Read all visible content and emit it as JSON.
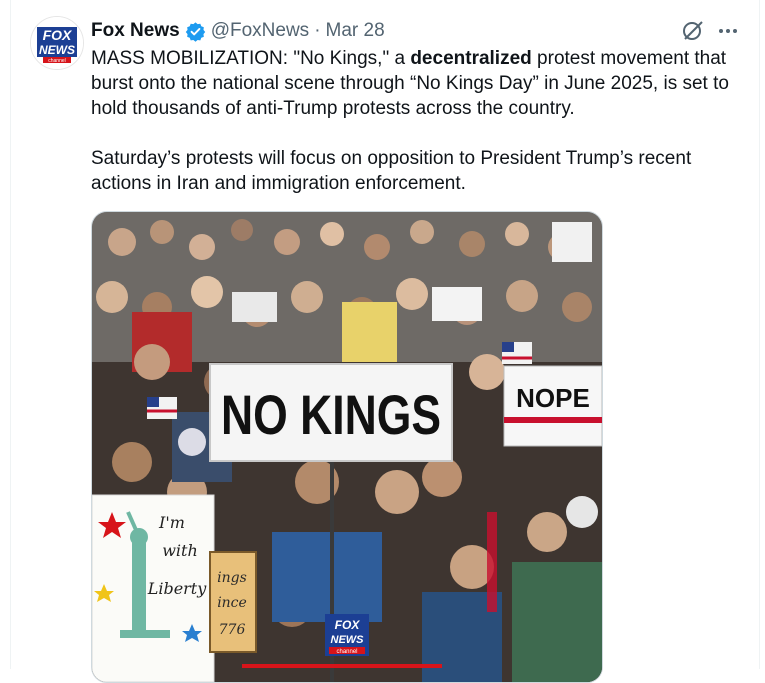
{
  "tweet": {
    "author_name": "Fox News",
    "handle": "@FoxNews",
    "separator": "·",
    "date": "Mar 28",
    "text_p1_prefix": "MASS MOBILIZATION: \"No Kings,\" a ",
    "text_p1_bold": "decentralized",
    "text_p1_suffix": " protest movement that burst onto the national scene through “No Kings Day” in June 2025, is set to hold thousands of anti-Trump protests across the country.",
    "text_p2": "Saturday’s protests will focus on opposition to President Trump’s recent actions in Iran and immigration enforcement."
  },
  "avatar": {
    "logo_line1": "FOX",
    "logo_line2": "NEWS",
    "logo_line3": "channel"
  },
  "photo": {
    "main_sign": "NO KINGS",
    "right_sign": "NOPE",
    "left_sign_line1": "I'm",
    "left_sign_line2": "with",
    "left_sign_line3": "Liberty",
    "partial_sign_line1": "ings",
    "partial_sign_line2": "ince",
    "partial_sign_line3": "776",
    "watermark_line1": "FOX",
    "watermark_line2": "NEWS",
    "watermark_line3": "channel"
  },
  "colors": {
    "verified": "#1d9bf0",
    "fox_blue": "#1c3f94",
    "fox_red": "#d7141a",
    "muted": "#536471"
  },
  "icons": {
    "verified": "verified-badge-icon",
    "grok": "grok-icon",
    "more": "more-icon"
  }
}
